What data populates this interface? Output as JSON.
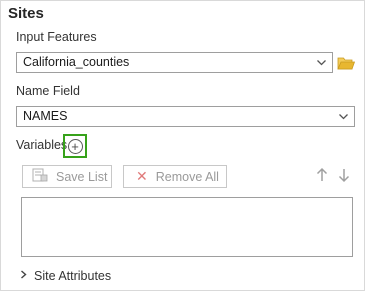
{
  "section": {
    "title": "Sites"
  },
  "input_features": {
    "label": "Input Features",
    "value": "California_counties",
    "dropdown_icon": "chevron-down-icon",
    "browse_icon": "folder-open-icon",
    "browse_color": "#e8b730"
  },
  "name_field": {
    "label": "Name Field",
    "value": "NAMES",
    "dropdown_icon": "chevron-down-icon"
  },
  "variables": {
    "label": "Variables",
    "add_icon": "add-circle-icon",
    "highlight_color": "#37a21a",
    "save_list_label": "Save List",
    "save_list_icon": "save-list-icon",
    "remove_all_label": "Remove All",
    "remove_all_icon": "close-icon",
    "remove_all_icon_color": "#e07a7a",
    "move_up_icon": "arrow-up-icon",
    "move_down_icon": "arrow-down-icon",
    "items": []
  },
  "site_attributes": {
    "label": "Site Attributes",
    "expand_icon": "chevron-right-icon"
  }
}
